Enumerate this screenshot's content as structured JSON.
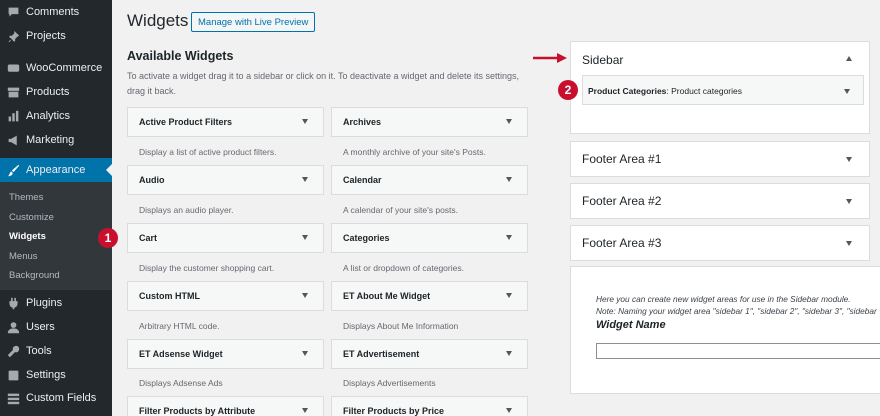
{
  "sidebar": {
    "items": [
      {
        "label": "Comments",
        "icon": "comments-icon"
      },
      {
        "label": "Projects",
        "icon": "pin-icon"
      },
      {
        "label": "WooCommerce",
        "icon": "woocommerce-icon"
      },
      {
        "label": "Products",
        "icon": "archive-icon"
      },
      {
        "label": "Analytics",
        "icon": "chart-bar-icon"
      },
      {
        "label": "Marketing",
        "icon": "megaphone-icon"
      },
      {
        "label": "Appearance",
        "icon": "paintbrush-icon"
      },
      {
        "label": "Plugins",
        "icon": "plugin-icon"
      },
      {
        "label": "Users",
        "icon": "users-icon"
      },
      {
        "label": "Tools",
        "icon": "wrench-icon"
      },
      {
        "label": "Settings",
        "icon": "settings-icon"
      },
      {
        "label": "Custom Fields",
        "icon": "custom-fields-icon"
      }
    ],
    "appearance_submenu": [
      "Themes",
      "Customize",
      "Widgets",
      "Menus",
      "Background"
    ],
    "active_submenu": "Widgets"
  },
  "page": {
    "title": "Widgets",
    "live_preview_button": "Manage with Live Preview"
  },
  "available": {
    "title": "Available Widgets",
    "description": "To activate a widget drag it to a sidebar or click on it. To deactivate a widget and delete its settings, drag it back.",
    "widgets": [
      {
        "title": "Active Product Filters",
        "desc": "Display a list of active product filters."
      },
      {
        "title": "Archives",
        "desc": "A monthly archive of your site's Posts."
      },
      {
        "title": "Audio",
        "desc": "Displays an audio player."
      },
      {
        "title": "Calendar",
        "desc": "A calendar of your site's posts."
      },
      {
        "title": "Cart",
        "desc": "Display the customer shopping cart."
      },
      {
        "title": "Categories",
        "desc": "A list or dropdown of categories."
      },
      {
        "title": "Custom HTML",
        "desc": "Arbitrary HTML code."
      },
      {
        "title": "ET About Me Widget",
        "desc": "Displays About Me Information"
      },
      {
        "title": "ET Adsense Widget",
        "desc": "Displays Adsense Ads"
      },
      {
        "title": "ET Advertisement",
        "desc": "Displays Advertisements"
      },
      {
        "title": "Filter Products by Attribute",
        "desc": ""
      },
      {
        "title": "Filter Products by Price",
        "desc": ""
      }
    ]
  },
  "sidebars": [
    {
      "title": "Sidebar",
      "expanded": true,
      "widget_name": "Product Categories",
      "widget_title": ": Product categories"
    },
    {
      "title": "Footer Area #1",
      "expanded": false
    },
    {
      "title": "Footer Area #2",
      "expanded": false
    },
    {
      "title": "Footer Area #3",
      "expanded": false
    }
  ],
  "create_area": {
    "line1": "Here you can create new widget areas for use in the Sidebar module.",
    "line2": "Note: Naming your widget area \"sidebar 1\", \"sidebar 2\", \"sidebar 3\", \"sidebar",
    "name_label": "Widget Name",
    "name_value": ""
  },
  "annotations": {
    "badge1": "1",
    "badge2": "2"
  },
  "colors": {
    "menu_bg": "#23282d",
    "submenu_bg": "#32373c",
    "accent": "#0073aa",
    "badge": "#c8102e"
  }
}
